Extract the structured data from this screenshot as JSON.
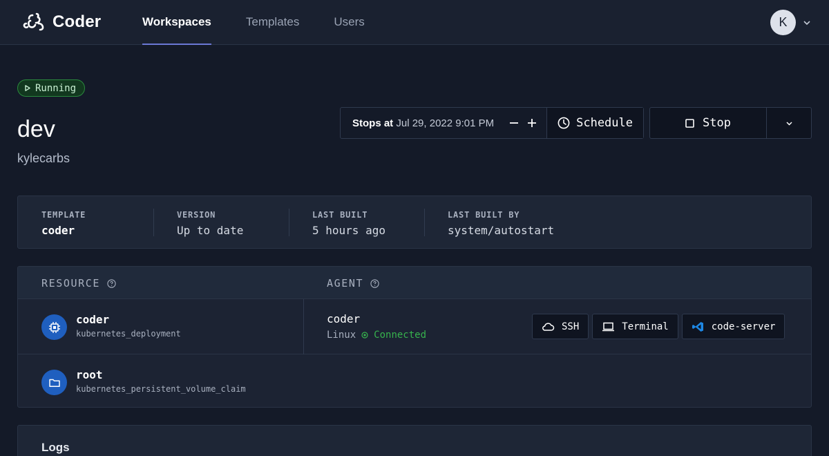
{
  "app": {
    "name": "Coder"
  },
  "nav": {
    "tabs": [
      {
        "label": "Workspaces",
        "active": true
      },
      {
        "label": "Templates",
        "active": false
      },
      {
        "label": "Users",
        "active": false
      }
    ]
  },
  "user": {
    "avatar_letter": "K"
  },
  "workspace": {
    "status": "Running",
    "name": "dev",
    "owner": "kylecarbs"
  },
  "schedule": {
    "stops_label": "Stops at",
    "stops_time": "Jul 29, 2022 9:01 PM",
    "decrease_icon": "minus-icon",
    "increase_icon": "plus-icon",
    "button_label": "Schedule"
  },
  "actions": {
    "stop_label": "Stop"
  },
  "stats": [
    {
      "label": "TEMPLATE",
      "value": "coder"
    },
    {
      "label": "VERSION",
      "value": "Up to date"
    },
    {
      "label": "LAST BUILT",
      "value": "5 hours ago"
    },
    {
      "label": "LAST BUILT BY",
      "value": "system/autostart"
    }
  ],
  "resources": {
    "headers": {
      "resource": "RESOURCE",
      "agent": "AGENT"
    },
    "rows": [
      {
        "name": "coder",
        "type": "kubernetes_deployment",
        "icon": "chip-icon",
        "agent": {
          "name": "coder",
          "os": "Linux",
          "status": "Connected",
          "buttons": [
            "SSH",
            "Terminal",
            "code-server"
          ]
        }
      },
      {
        "name": "root",
        "type": "kubernetes_persistent_volume_claim",
        "icon": "folder-icon"
      }
    ]
  },
  "logs": {
    "title": "Logs"
  },
  "colors": {
    "background": "#141a28",
    "accent": "#6b78d6",
    "running": "#2b8a3e",
    "connected": "#37b24d",
    "resource_icon": "#1f5fbf"
  }
}
